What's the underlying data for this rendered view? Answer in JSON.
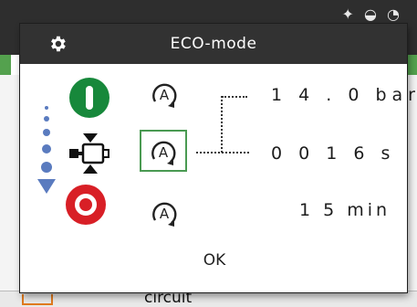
{
  "background": {
    "footer_text": "circuit"
  },
  "dialog": {
    "title": "ECO-mode",
    "header_icon": "gear-icon",
    "ok_label": "OK",
    "rows": [
      {
        "icon": "start-icon",
        "mode": "A",
        "value": "1 4 . 0 bar"
      },
      {
        "icon": "valve-icon",
        "mode": "A",
        "value": "0 0 1 6 s",
        "selected": true
      },
      {
        "icon": "stop-icon",
        "mode": "A",
        "value": "1 5 min"
      }
    ]
  },
  "colors": {
    "header": "#323232",
    "start_green": "#17883b",
    "stop_red": "#d81f26",
    "selection_green": "#4a9a52",
    "indicator_blue": "#5a7bbf"
  }
}
